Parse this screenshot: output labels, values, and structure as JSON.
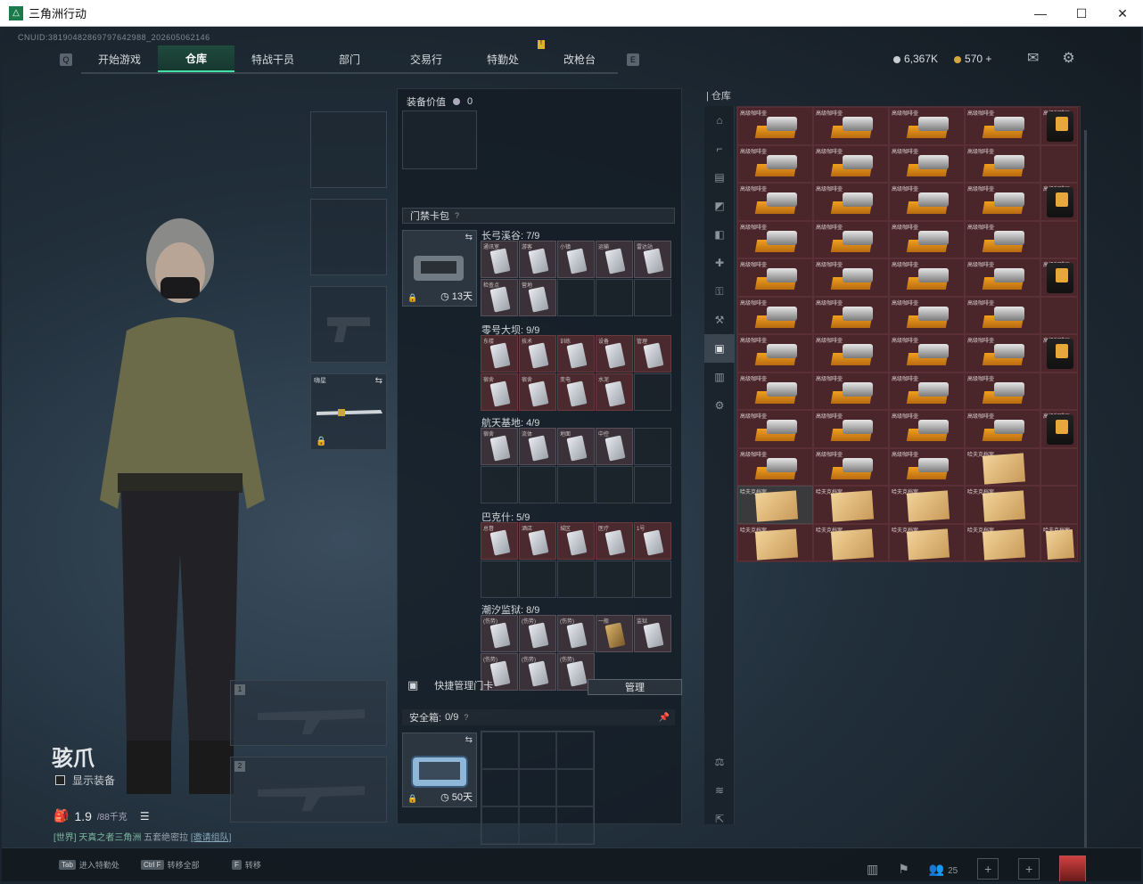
{
  "window": {
    "title": "三角洲行动"
  },
  "uid": "CNUID:38190482869797642988_202605062146",
  "nav": {
    "tabs": [
      {
        "label": "开始游戏"
      },
      {
        "label": "仓库",
        "active": true
      },
      {
        "label": "特战干员"
      },
      {
        "label": "部门"
      },
      {
        "label": "交易行"
      },
      {
        "label": "特勤处",
        "badge": "!"
      },
      {
        "label": "改枪台"
      }
    ]
  },
  "currency": {
    "coins": "6,367K",
    "bonds": "570",
    "plus": "+"
  },
  "character": {
    "name": "骇爪",
    "show_equipment": "显示装备",
    "weight": "1.9",
    "weight_max": "/88千克",
    "chat_channel": "[世界]",
    "chat_user": "天真之者三角洲",
    "chat_text": "五套绝密拉",
    "chat_link": "[邀请组队]"
  },
  "melee_slot": {
    "label": "嗨星"
  },
  "weapon_slots": [
    {
      "num": "1"
    },
    {
      "num": "2"
    }
  ],
  "equipment": {
    "value_label": "装备价值",
    "value": "0",
    "keycard_bag": "门禁卡包",
    "help": "?",
    "keycard_days": "13天",
    "maps": [
      {
        "label": "长弓溪谷: 7/9",
        "cards": [
          "通讯室",
          "游客",
          "小镇",
          "运输",
          "雷达站",
          "检查点",
          "营地"
        ],
        "rows": 2
      },
      {
        "label": "零号大坝: 9/9",
        "cards": [
          "东楼",
          "技术",
          "训练",
          "设备",
          "管理",
          "宿舍",
          "宿舍",
          "变电",
          "水泥"
        ],
        "rows": 2
      },
      {
        "label": "航天基地: 4/9",
        "cards": [
          "宿舍",
          "流体",
          "地面",
          "中控"
        ],
        "rows": 2
      },
      {
        "label": "巴克什: 5/9",
        "cards": [
          "总督",
          "酒店",
          "城区",
          "医疗",
          "1号"
        ],
        "rows": 2
      },
      {
        "label": "潮汐监狱: 8/9",
        "cards": [
          "(伤势)",
          "(伤势)",
          "(伤势)",
          "一般",
          "监狱",
          "(伤势)",
          "(伤势)",
          "(伤势)"
        ],
        "rows": 2
      }
    ],
    "quick_manage": "快捷管理门卡",
    "manage_btn": "管理",
    "safebox_label": "安全箱:",
    "safebox_count": "0/9",
    "safebox_days": "50天"
  },
  "warehouse": {
    "title": "仓库",
    "coffee_label": "高级咖啡壶",
    "bag_label": "高级咖啡豆",
    "paper_label": "哈夫克档案"
  },
  "bottom": {
    "hints": [
      {
        "key": "Tab",
        "label": "进入特勤处"
      },
      {
        "key": "Ctrl F",
        "label": "转移全部"
      },
      {
        "key": "F",
        "label": "转移"
      }
    ],
    "friends": "25"
  },
  "colors": {
    "accent": "#3fe3a5",
    "badge": "#e0b12a",
    "inventory_red": "#4a262b"
  }
}
